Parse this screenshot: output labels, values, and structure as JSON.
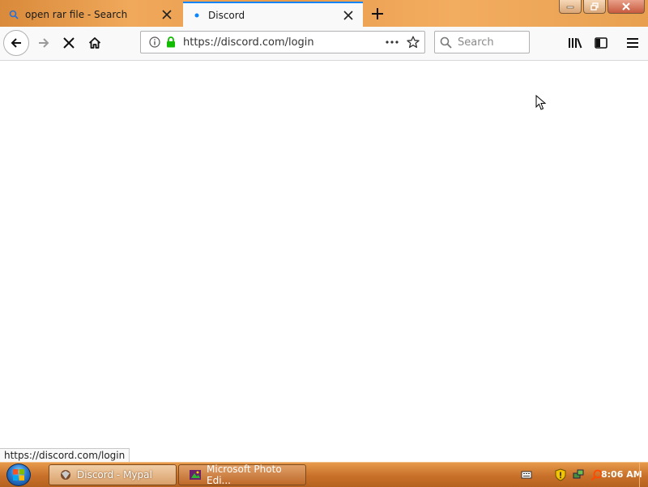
{
  "tabs": [
    {
      "title": "open rar file - Search",
      "favicon": "search-icon"
    },
    {
      "title": "Discord",
      "favicon": "loading-dot-icon"
    }
  ],
  "toolbar": {
    "url": "https://discord.com/login",
    "search_placeholder": "Search"
  },
  "status": {
    "text": "https://discord.com/login"
  },
  "taskbar": {
    "items": [
      {
        "label": "Discord - Mypal"
      },
      {
        "label": "Microsoft Photo Edi..."
      }
    ],
    "clock": "8:06 AM"
  },
  "colors": {
    "accent": "#0a84ff",
    "lock_green": "#12bc00",
    "taskbar": "#d9843a"
  }
}
